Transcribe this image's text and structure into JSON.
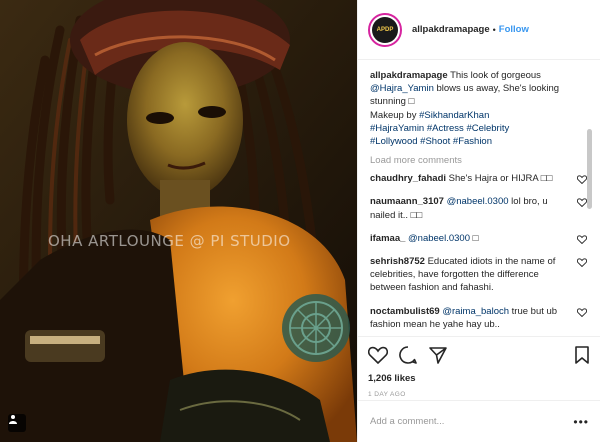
{
  "photo": {
    "watermark": "OHA ARTLOUNGE @ PI STUDIO",
    "user_tag_icon": "person-tag-icon"
  },
  "header": {
    "username": "allpakdramapage",
    "dot": "•",
    "follow_label": "Follow",
    "avatar_text": "APDP"
  },
  "caption": {
    "username": "allpakdramapage",
    "text_1": " This look of gorgeous ",
    "mention": "@Hajra_Yamin",
    "text_2": " blows us away, She's looking stunning □",
    "makeup_prefix": "Makeup by ",
    "makeup_tag": "#SikhandarKhan",
    "hashtags_line1": "#HajraYamin #Actress #Celebrity",
    "hashtags_line2": "#Lollywood #Shoot #Fashion"
  },
  "load_more_label": "Load more comments",
  "comments": [
    {
      "username": "chaudhry_fahadi",
      "mention": "",
      "text": " She's Hajra or HIJRA □□"
    },
    {
      "username": "naumaann_3107",
      "mention": "@nabeel.0300",
      "text": " lol bro, u nailed it.. □□"
    },
    {
      "username": "ifamaa_",
      "mention": "@nabeel.0300",
      "text": " □"
    },
    {
      "username": "sehrish8752",
      "mention": "",
      "text": " Educated idiots in the name of celebrities, have forgotten the difference between fashion and fahashi."
    },
    {
      "username": "noctambulist69",
      "mention": "@raima_baloch",
      "text": " true but ub fashion mean he yahe hay ub.."
    }
  ],
  "actions": {
    "like_icon": "heart-icon",
    "comment_icon": "comment-bubble-icon",
    "share_icon": "share-icon",
    "save_icon": "bookmark-icon",
    "likes_text": "1,206 likes",
    "posted_text": "1 DAY AGO"
  },
  "add_comment": {
    "placeholder": "Add a comment...",
    "more_label": "•••"
  },
  "colors": {
    "link": "#003569",
    "follow": "#3897f0",
    "muted": "#999999",
    "text": "#262626"
  }
}
